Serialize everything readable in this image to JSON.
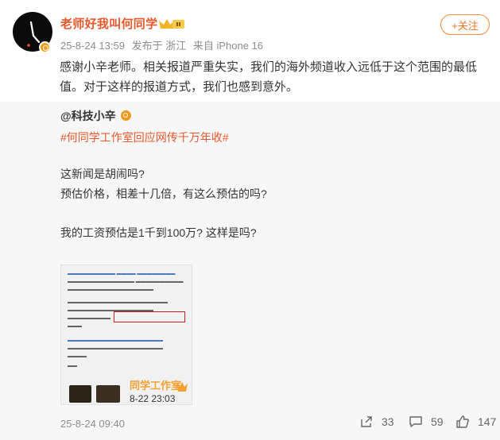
{
  "author": {
    "name": "老师好我叫何同学",
    "avatar_icon": "avatar-clock-hands",
    "badge_icon": "verified-gold-badge",
    "crown_icon": "vip-crown-icon"
  },
  "meta": {
    "time": "25-8-24 13:59",
    "location": "发布于 浙江",
    "device": "来自 iPhone 16"
  },
  "follow_label": "+关注",
  "post_text": "感谢小辛老师。相关报道严重失实，我们的海外频道收入远低于这个范围的最低值。对于这样的报道方式，我们也感到意外。",
  "repost": {
    "author": "@科技小辛",
    "hashtag": "#何同学工作室回应网传千万年收#",
    "lines": [
      "这新闻是胡闹吗?",
      "预估价格，相差十几倍，有这么预估的吗?",
      "我的工资预估是1千到100万? 这样是吗?"
    ],
    "image": {
      "studio_text": "同学工作室",
      "date_text": "8-22 23:03"
    },
    "time": "25-8-24 09:40",
    "actions": {
      "repost_count": "33",
      "comment_count": "59",
      "like_count": "147"
    }
  },
  "colors": {
    "accent": "#e8582a",
    "follow": "#f1782a",
    "gray": "#8c8c8c",
    "repost_bg": "#f7f7f7"
  }
}
